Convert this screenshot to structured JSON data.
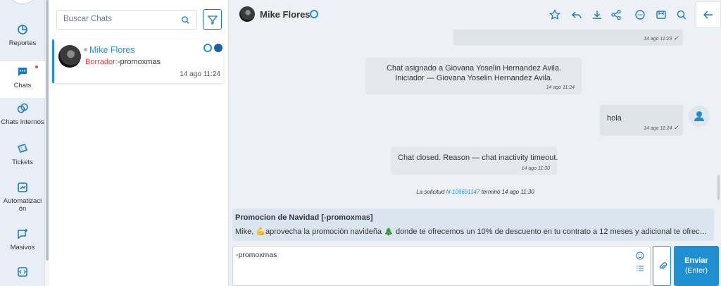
{
  "nav": {
    "items": [
      {
        "label": "Reportes",
        "icon": "pie-chart-icon"
      },
      {
        "label": "Chats",
        "icon": "chat-bubble-icon",
        "has_dot": true
      },
      {
        "label": "Chats internos",
        "icon": "internal-chat-icon"
      },
      {
        "label": "Tickets",
        "icon": "ticket-icon"
      },
      {
        "label": "Automatización",
        "icon": "automation-icon"
      },
      {
        "label": "Masivos",
        "icon": "broadcast-icon"
      }
    ]
  },
  "chat_list": {
    "search_placeholder": "Buscar Chats",
    "chats": [
      {
        "name": "Mike Flores",
        "draft_label": "Borrador:",
        "draft_text": "-promoxmas",
        "time": "14 ago 11:24"
      }
    ]
  },
  "header": {
    "contact_name": "Mike Flores",
    "actions": [
      "star-icon",
      "reply-icon",
      "download-icon",
      "share-icon",
      "comment-icon",
      "inbox-icon",
      "search-icon",
      "back-arrow-icon"
    ]
  },
  "messages": [
    {
      "type": "outgoing",
      "time": "14 ago 11:23",
      "text": ""
    },
    {
      "type": "system",
      "text": "Chat asignado a Giovana Yoselin Hernandez Avila. Iniciador — Giovana Yoselin Hernandez Avila.",
      "time": "14 ago 11:24"
    },
    {
      "type": "outgoing",
      "text": "hola",
      "time": "14 ago 11:24"
    },
    {
      "type": "system",
      "text": "Chat closed. Reason — chat inactivity timeout.",
      "time": "14 ago 11:30"
    }
  ],
  "closure": {
    "prefix": "La solicitud",
    "ticket": "N-109691147",
    "suffix": "terminó 14 ago 11:30"
  },
  "template": {
    "title": "Promocion de Navidad [-promoxmas]",
    "body": "Mike, 💪aprovecha la promoción navideña 🎄 donde te ofrecemos un 10% de descuento en tu contrato a 12 meses y adicional te ofrecemos e..."
  },
  "composer": {
    "value": "-promoxmas",
    "send_label": "Enviar",
    "send_hint": "(Enter)"
  },
  "colors": {
    "accent": "#1f8fd1",
    "draft": "#e0423a"
  }
}
